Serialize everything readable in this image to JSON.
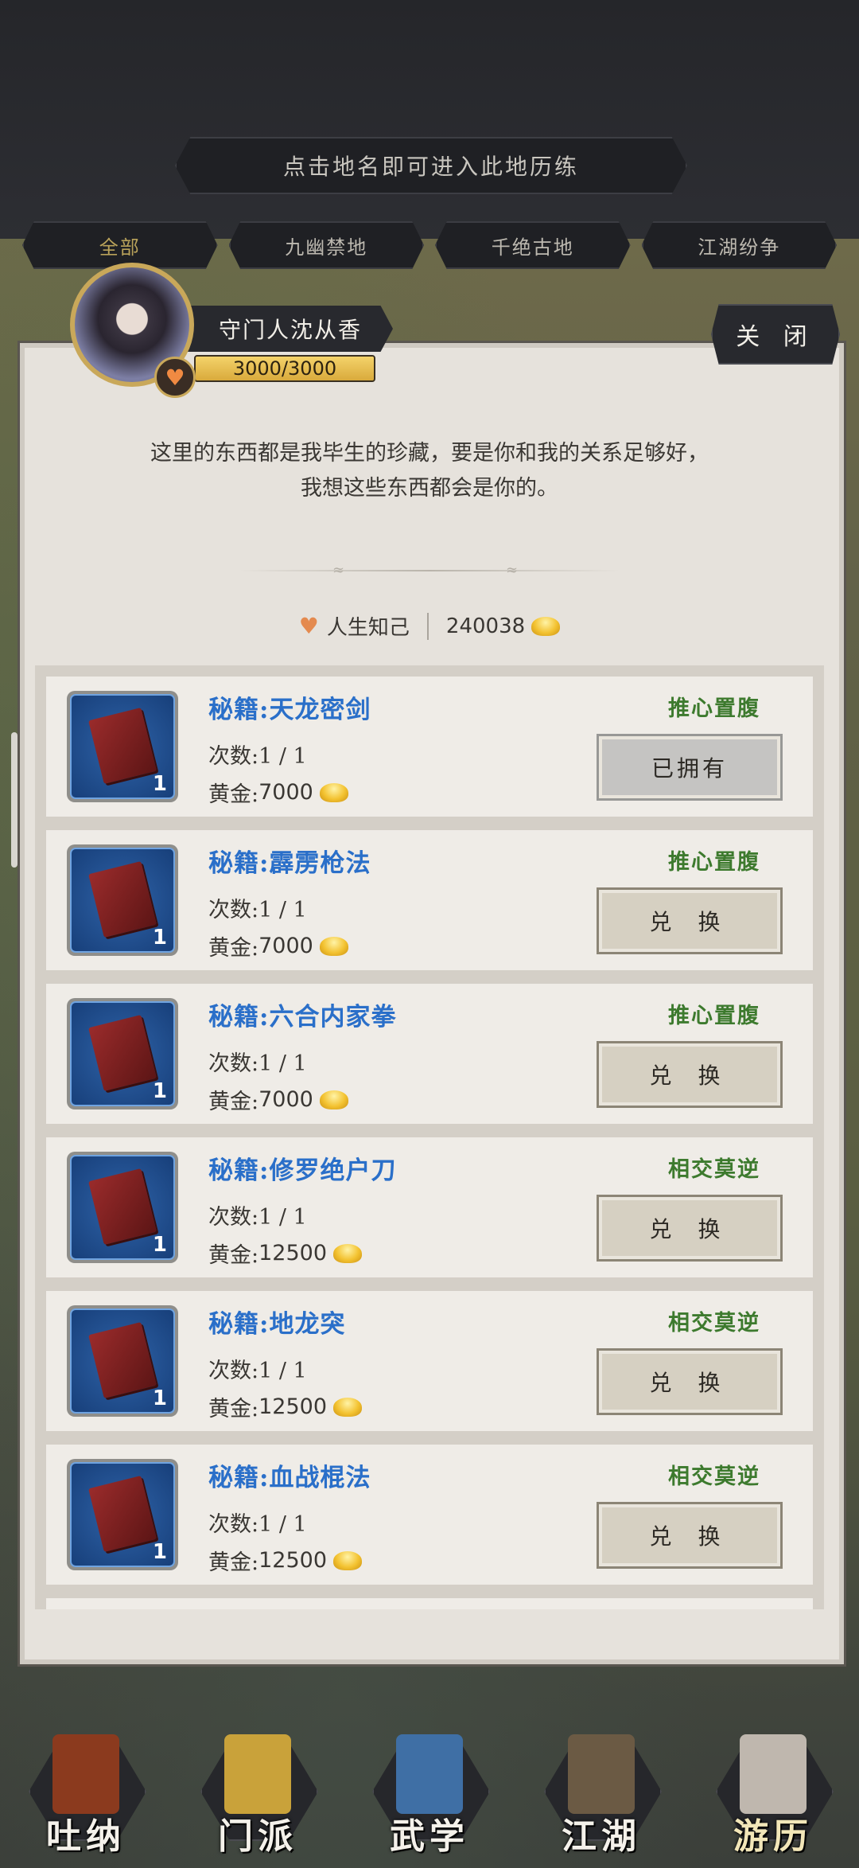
{
  "hint": "点击地名即可进入此地历练",
  "tabs": [
    {
      "label": "全部",
      "active": true
    },
    {
      "label": "九幽禁地",
      "active": false
    },
    {
      "label": "千绝古地",
      "active": false
    },
    {
      "label": "江湖纷争",
      "active": false
    }
  ],
  "npc": {
    "name": "守门人沈从香",
    "hp_text": "3000/3000",
    "hp_fraction": 1.0
  },
  "close_label": "关 闭",
  "description": [
    "这里的东西都是我毕生的珍藏，要是你和我的关系足够好，",
    "我想这些东西都会是你的。"
  ],
  "stats": {
    "relation": "人生知己",
    "gold": "240038"
  },
  "items": [
    {
      "name": "秘籍:天龙密剑",
      "count": "次数:1 / 1",
      "price_label": "黄金:",
      "price": "7000",
      "requirement": "推心置腹",
      "button": "已拥有",
      "owned": true,
      "qty": "1"
    },
    {
      "name": "秘籍:霹雳枪法",
      "count": "次数:1 / 1",
      "price_label": "黄金:",
      "price": "7000",
      "requirement": "推心置腹",
      "button": "兑 换",
      "owned": false,
      "qty": "1"
    },
    {
      "name": "秘籍:六合内家拳",
      "count": "次数:1 / 1",
      "price_label": "黄金:",
      "price": "7000",
      "requirement": "推心置腹",
      "button": "兑 换",
      "owned": false,
      "qty": "1"
    },
    {
      "name": "秘籍:修罗绝户刀",
      "count": "次数:1 / 1",
      "price_label": "黄金:",
      "price": "12500",
      "requirement": "相交莫逆",
      "button": "兑 换",
      "owned": false,
      "qty": "1"
    },
    {
      "name": "秘籍:地龙突",
      "count": "次数:1 / 1",
      "price_label": "黄金:",
      "price": "12500",
      "requirement": "相交莫逆",
      "button": "兑 换",
      "owned": false,
      "qty": "1"
    },
    {
      "name": "秘籍:血战棍法",
      "count": "次数:1 / 1",
      "price_label": "黄金:",
      "price": "12500",
      "requirement": "相交莫逆",
      "button": "兑 换",
      "owned": false,
      "qty": "1"
    }
  ],
  "nav": [
    {
      "label": "吐纳",
      "icon": "meditation-icon",
      "color": "#8b3a1e"
    },
    {
      "label": "门派",
      "icon": "sect-banner-icon",
      "color": "#c9a23a"
    },
    {
      "label": "武学",
      "icon": "martial-book-icon",
      "color": "#3f6fa5"
    },
    {
      "label": "江湖",
      "icon": "bamboo-hat-icon",
      "color": "#6b5a44"
    },
    {
      "label": "游历",
      "icon": "horse-icon",
      "color": "#bfb7ae"
    }
  ]
}
